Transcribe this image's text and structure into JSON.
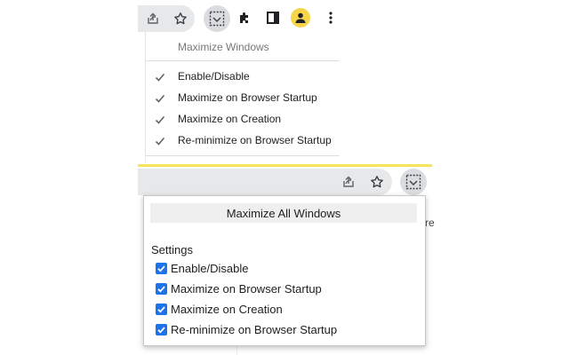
{
  "toolbar_top": {
    "icons": [
      "share-icon",
      "star-icon",
      "maximize-extension-icon",
      "puzzle-icon",
      "side-panel-icon",
      "avatar-icon",
      "more-icon"
    ]
  },
  "context_menu": {
    "title": "Maximize Windows",
    "items": [
      {
        "label": "Enable/Disable",
        "checked": true
      },
      {
        "label": "Maximize on Browser Startup",
        "checked": true
      },
      {
        "label": "Maximize on Creation",
        "checked": true
      },
      {
        "label": "Re-minimize on Browser Startup",
        "checked": true
      }
    ]
  },
  "toolbar_bottom": {
    "icons": [
      "share-icon",
      "star-icon",
      "maximize-extension-icon"
    ]
  },
  "popup": {
    "button_label": "Maximize All Windows",
    "settings_label": "Settings",
    "options": [
      {
        "label": "Enable/Disable",
        "checked": true
      },
      {
        "label": "Maximize on Browser Startup",
        "checked": true
      },
      {
        "label": "Maximize on Creation",
        "checked": true
      },
      {
        "label": "Re-minimize on Browser Startup",
        "checked": true
      }
    ]
  },
  "background_text": "re",
  "colors": {
    "accent_yellow": "#f7e45a",
    "checkbox_blue": "#1a73e8",
    "avatar_yellow": "#f7d54a",
    "toolbar_gray": "#e7e8ea"
  }
}
